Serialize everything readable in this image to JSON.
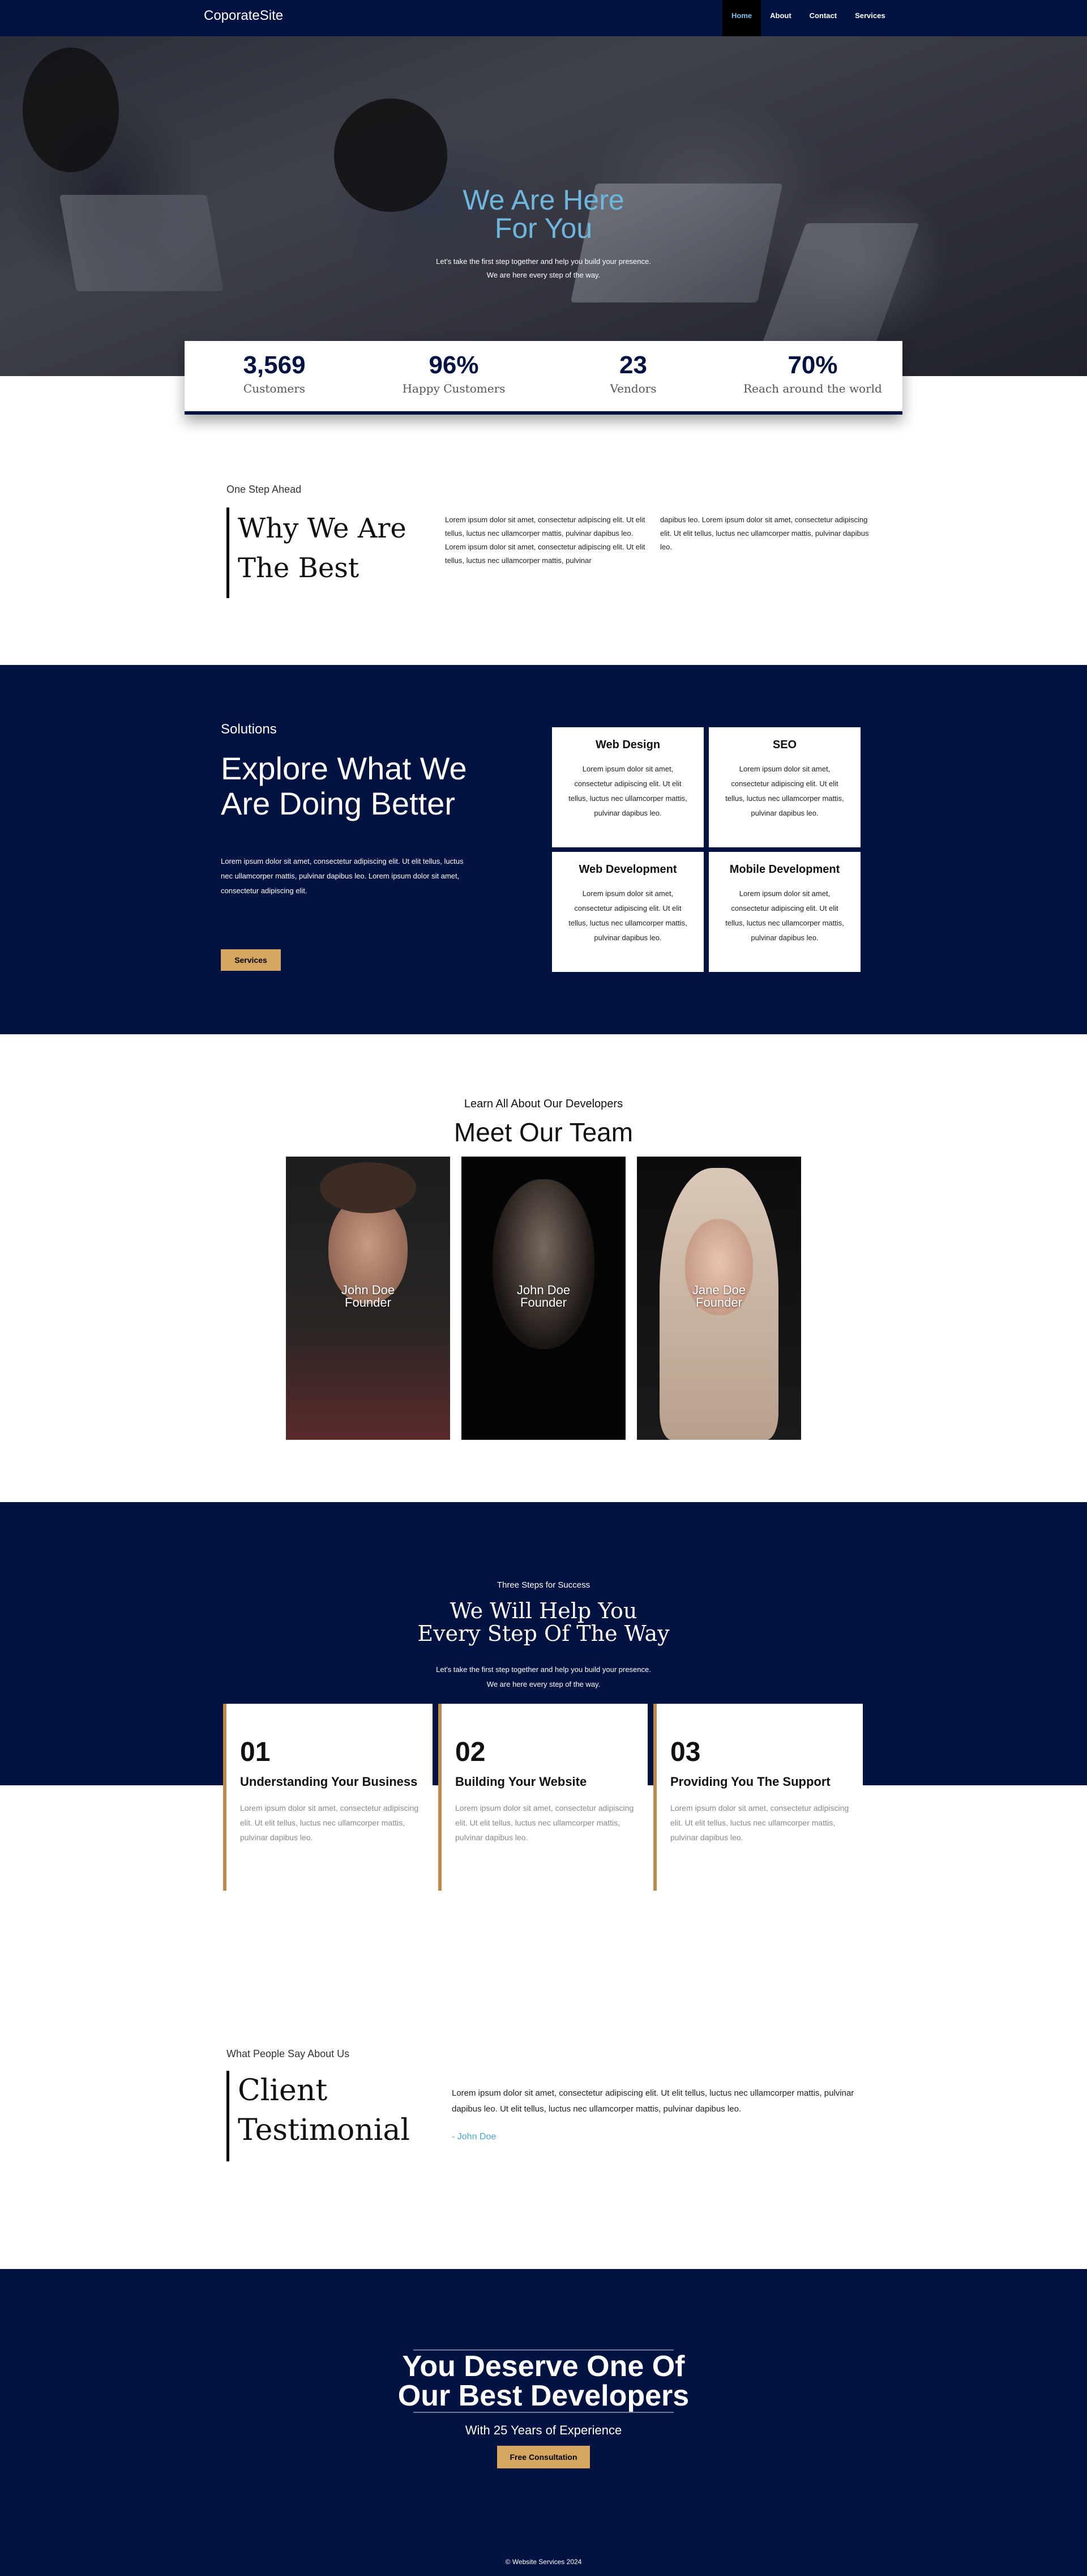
{
  "brand": "CoporateSite",
  "nav": {
    "home": "Home",
    "about": "About",
    "contact": "Contact",
    "services": "Services"
  },
  "hero": {
    "title_line1": "We Are Here",
    "title_line2": "For You",
    "sub_line1": "Let's take the first step together and help you build your presence.",
    "sub_line2": "We are here every step of the way."
  },
  "stats": [
    {
      "value": "3,569",
      "label": "Customers"
    },
    {
      "value": "96%",
      "label": "Happy Customers"
    },
    {
      "value": "23",
      "label": "Vendors"
    },
    {
      "value": "70%",
      "label": "Reach around the world"
    }
  ],
  "why": {
    "kicker": "One Step Ahead",
    "title_line1": "Why We Are",
    "title_line2": "The Best",
    "col1": "Lorem ipsum dolor sit amet, consectetur adipiscing elit. Ut elit tellus, luctus nec ullamcorper mattis, pulvinar dapibus leo. Lorem ipsum dolor sit amet, consectetur adipiscing elit. Ut elit tellus, luctus nec ullamcorper mattis, pulvinar",
    "col2": "dapibus leo. Lorem ipsum dolor sit amet, consectetur adipiscing elit. Ut elit tellus, luctus nec ullamcorper mattis, pulvinar dapibus leo."
  },
  "solutions": {
    "kicker": "Solutions",
    "title_line1": "Explore What We",
    "title_line2": "Are Doing Better",
    "desc": "Lorem ipsum dolor sit amet, consectetur adipiscing elit. Ut elit tellus, luctus nec ullamcorper mattis, pulvinar dapibus leo. Lorem ipsum dolor sit amet, consectetur adipiscing elit.",
    "button": "Services",
    "cards": [
      {
        "title": "Web Design",
        "text": "Lorem ipsum dolor sit amet, consectetur adipiscing elit. Ut elit tellus, luctus nec ullamcorper mattis, pulvinar dapibus leo."
      },
      {
        "title": "SEO",
        "text": "Lorem ipsum dolor sit amet, consectetur adipiscing elit. Ut elit tellus, luctus nec ullamcorper mattis, pulvinar dapibus leo."
      },
      {
        "title": "Web Development",
        "text": "Lorem ipsum dolor sit amet, consectetur adipiscing elit. Ut elit tellus, luctus nec ullamcorper mattis, pulvinar dapibus leo."
      },
      {
        "title": "Mobile Development",
        "text": "Lorem ipsum dolor sit amet, consectetur adipiscing elit. Ut elit tellus, luctus nec ullamcorper mattis, pulvinar dapibus leo."
      }
    ]
  },
  "team": {
    "kicker": "Learn All About Our Developers",
    "title": "Meet Our Team",
    "members": [
      {
        "name": "John Doe",
        "role": "Founder"
      },
      {
        "name": "John Doe",
        "role": "Founder"
      },
      {
        "name": "Jane Doe",
        "role": "Founder"
      }
    ]
  },
  "steps": {
    "kicker": "Three Steps for Success",
    "title_line1": "We Will Help You",
    "title_line2": "Every Step Of The Way",
    "sub_line1": "Let's take the first step together and help you build your presence.",
    "sub_line2": "We are here every step of the way.",
    "items": [
      {
        "num": "01",
        "title": "Understanding Your Business",
        "text": "Lorem ipsum dolor sit amet, consectetur adipiscing elit. Ut elit tellus, luctus nec ullamcorper mattis, pulvinar dapibus leo."
      },
      {
        "num": "02",
        "title": "Building Your Website",
        "text": "Lorem ipsum dolor sit amet, consectetur adipiscing elit. Ut elit tellus, luctus nec ullamcorper mattis, pulvinar dapibus leo."
      },
      {
        "num": "03",
        "title": "Providing You The Support",
        "text": "Lorem ipsum dolor sit amet, consectetur adipiscing elit. Ut elit tellus, luctus nec ullamcorper mattis, pulvinar dapibus leo."
      }
    ]
  },
  "testimonial": {
    "kicker": "What People Say About Us",
    "title_line1": "Client",
    "title_line2": "Testimonial",
    "quote": "Lorem ipsum dolor sit amet, consectetur adipiscing elit. Ut elit tellus, luctus nec ullamcorper mattis, pulvinar dapibus leo. Ut elit tellus, luctus nec ullamcorper mattis, pulvinar dapibus leo.",
    "author": "- John Doe"
  },
  "cta": {
    "title_line1": "You Deserve One Of",
    "title_line2": "Our Best Developers",
    "sub": "With 25 Years of Experience",
    "button": "Free Consultation"
  },
  "footer": "© Website Services 2024",
  "colors": {
    "navy": "#021241",
    "gold": "#d4a65f",
    "accent_blue": "#6fb6dc",
    "step_border": "#bc8a4b"
  }
}
